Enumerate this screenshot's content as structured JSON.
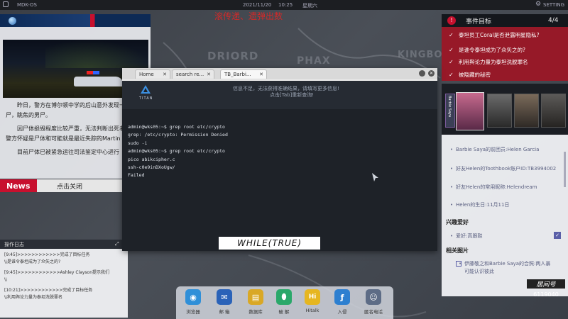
{
  "topbar": {
    "os_name": "MDK-OS",
    "date": "2021/11/20",
    "time": "10:25",
    "weekday": "星期六",
    "setting_label": "SETTING"
  },
  "overlay_title": "滚传递、遗弹出数",
  "map": {
    "labels": [
      "DRIORD",
      "PHAX",
      "KINGBO"
    ]
  },
  "news": {
    "body": [
      "昨日，警方在博尔顿中学的后山意外发现一具无名男尸，眺焦的男尸。",
      "因尸体损毁程度比较严重，无法判断出死者身份，但警方怀疑是尸体和可能就是最近失踪的Martin Hill。",
      "目前尸体已被紧急运往司法鉴定中心进行"
    ],
    "tag": "News",
    "close_label": "点击关闭"
  },
  "oplog": {
    "title": "操作日志",
    "expand_label": "展开",
    "entries": [
      "[9:45]>>>>>>>>>>>>完成了目标任务",
      "\\\\是谁令泰坦成为了众矢之的?",
      "[9:45]>>>>>>>>>>>>Ashley Clayson提示我们",
      "\\\\",
      "[10:21]>>>>>>>>>>>>完成了目标任务",
      "\\\\利用舆论力量为泰坦洗脱罪名"
    ]
  },
  "events": {
    "title": "事件目标",
    "count": "4/4",
    "items": [
      "泰坦员工Coral是否泄露明星隐私?",
      "是谁令泰坦成为了众矢之的?",
      "利用舆论力量为泰坦洗脱罪名",
      "被隐藏的秘密"
    ]
  },
  "browser": {
    "tabs": [
      "Home",
      "search re...",
      "TB_Barbi..."
    ],
    "logo_text": "TITAN",
    "notice_line1": "信息不足，无法获得准确结果，请填写更多信息!",
    "notice_line2": "点击[Tab]重新查询!",
    "notice_tab_word": "Tab",
    "terminal_lines": [
      "admin@wks05:~$ grep root etc/crypto",
      "grep: /etc/crypto: Permission Denied",
      "sudo -i",
      "admin@wks05:~$ grep root etc/crypto",
      "pico abikcipher.c",
      "ssh-c0e9inDXoUgw/",
      "Failed"
    ],
    "footer_logo": "WHILE(TRUE)"
  },
  "profile": {
    "name_tag": "Barbie Saya",
    "items": [
      "Barbie Saya的前团员:Helen Garcia",
      "好友Helen的Toothbook账户ID:TB3994002",
      "好友Helen的常用昵称:Helendream",
      "Helen的生日:11月11日"
    ],
    "hobby_title": "兴趣爱好",
    "hobby_item": "爱好:高跟鞋",
    "related_title": "相关图片",
    "related_item": "伊藤敬之和Barbie Saya的合照:两人暴可能认识彼此"
  },
  "phone": {
    "label": "居间号",
    "number": "6119040"
  },
  "dock": [
    {
      "label": "浏览器",
      "icon": "browser-icon",
      "color": "#2f8fd8",
      "glyph": "◉"
    },
    {
      "label": "邮 箱",
      "icon": "mail-icon",
      "color": "#2a62b8",
      "glyph": "✉"
    },
    {
      "label": "数据库",
      "icon": "database-icon",
      "color": "#d9a826",
      "glyph": "▤"
    },
    {
      "label": "破 解",
      "icon": "crack-icon",
      "color": "#2aa86a",
      "glyph": "⬮"
    },
    {
      "label": "Hitalk",
      "icon": "hitalk-icon",
      "color": "#e6b620",
      "glyph": "Hi"
    },
    {
      "label": "入侵",
      "icon": "intrude-icon",
      "color": "#2d7fd0",
      "glyph": "ƒ"
    },
    {
      "label": "匿名电话",
      "icon": "anon-call-icon",
      "color": "#5d6c86",
      "glyph": "☺"
    }
  ],
  "colors": {
    "accent_red": "#c8102e",
    "terminal_bg": "#1e2228",
    "dark_bar": "#1c1e22"
  }
}
